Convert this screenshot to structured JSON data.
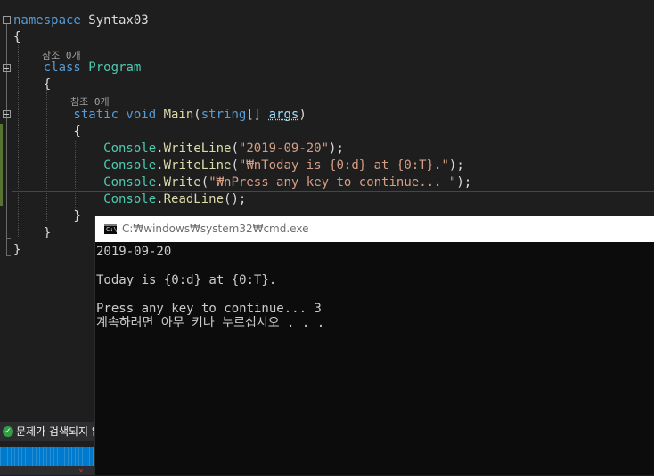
{
  "editor": {
    "lines": [
      {
        "kind": "code",
        "tokens": [
          {
            "t": "namespace",
            "c": "kw"
          },
          {
            "t": " Syntax03",
            "c": "punc"
          }
        ]
      },
      {
        "kind": "code",
        "tokens": [
          {
            "t": "{",
            "c": "punc"
          }
        ]
      },
      {
        "kind": "lens",
        "text": "참조 0개"
      },
      {
        "kind": "code",
        "tokens": [
          {
            "t": "    class ",
            "c": "kw"
          },
          {
            "t": "Program",
            "c": "type"
          }
        ]
      },
      {
        "kind": "code",
        "tokens": [
          {
            "t": "    {",
            "c": "punc"
          }
        ]
      },
      {
        "kind": "lens",
        "text": "참조 0개"
      },
      {
        "kind": "code",
        "tokens": [
          {
            "t": "        static void ",
            "c": "kw"
          },
          {
            "t": "Main",
            "c": "method"
          },
          {
            "t": "(",
            "c": "punc"
          },
          {
            "t": "string",
            "c": "kw"
          },
          {
            "t": "[] ",
            "c": "punc"
          },
          {
            "t": "args",
            "c": "param"
          },
          {
            "t": ")",
            "c": "punc"
          }
        ]
      },
      {
        "kind": "code",
        "tokens": [
          {
            "t": "        {",
            "c": "punc"
          }
        ]
      },
      {
        "kind": "code",
        "tokens": [
          {
            "t": "            Console",
            "c": "type"
          },
          {
            "t": ".",
            "c": "punc"
          },
          {
            "t": "WriteLine",
            "c": "method"
          },
          {
            "t": "(",
            "c": "punc"
          },
          {
            "t": "\"2019-09-20\"",
            "c": "str"
          },
          {
            "t": ");",
            "c": "punc"
          }
        ]
      },
      {
        "kind": "code",
        "tokens": [
          {
            "t": "            Console",
            "c": "type"
          },
          {
            "t": ".",
            "c": "punc"
          },
          {
            "t": "WriteLine",
            "c": "method"
          },
          {
            "t": "(",
            "c": "punc"
          },
          {
            "t": "\"₩nToday is {0:d} at {0:T}.\"",
            "c": "str"
          },
          {
            "t": ");",
            "c": "punc"
          }
        ]
      },
      {
        "kind": "code",
        "tokens": [
          {
            "t": "            Console",
            "c": "type"
          },
          {
            "t": ".",
            "c": "punc"
          },
          {
            "t": "Write",
            "c": "method"
          },
          {
            "t": "(",
            "c": "punc"
          },
          {
            "t": "\"₩nPress any key to continue... \"",
            "c": "str"
          },
          {
            "t": ");",
            "c": "punc"
          }
        ]
      },
      {
        "kind": "code",
        "tokens": [
          {
            "t": "            Console",
            "c": "type"
          },
          {
            "t": ".",
            "c": "punc"
          },
          {
            "t": "ReadLine",
            "c": "method"
          },
          {
            "t": "();",
            "c": "punc"
          }
        ]
      },
      {
        "kind": "code",
        "tokens": [
          {
            "t": "        }",
            "c": "punc"
          }
        ]
      },
      {
        "kind": "code",
        "tokens": [
          {
            "t": "    }",
            "c": "punc"
          }
        ]
      },
      {
        "kind": "code",
        "tokens": [
          {
            "t": "}",
            "c": "punc"
          }
        ]
      }
    ]
  },
  "status": {
    "issues_text": "문제가 검색되지 않",
    "issues_icon": "check-circle-icon"
  },
  "console": {
    "title": "C:₩windows₩system32₩cmd.exe",
    "output": [
      "2019-09-20",
      "",
      "Today is {0:d} at {0:T}.",
      "",
      "Press any key to continue... 3",
      "계속하려면 아무 키나 누르십시오 . . ."
    ]
  }
}
